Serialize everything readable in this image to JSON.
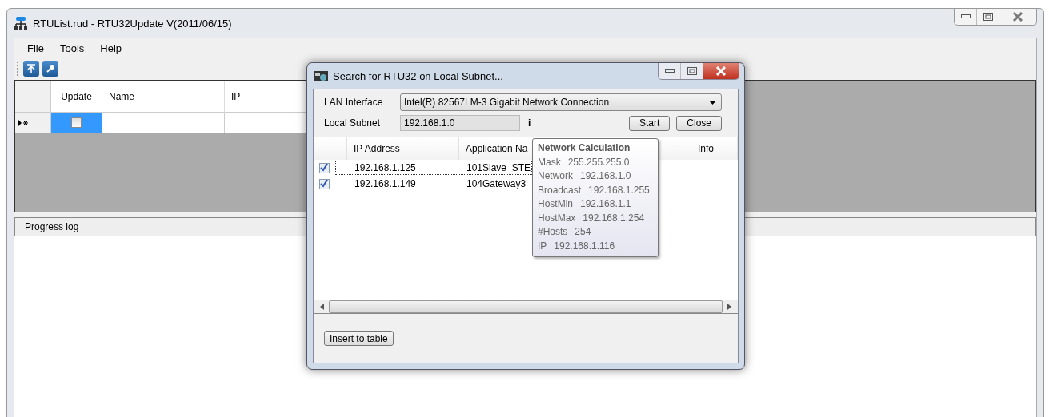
{
  "window": {
    "title": "RTUList.rud - RTU32Update V(2011/06/15)"
  },
  "menu": [
    "File",
    "Tools",
    "Help"
  ],
  "grid": {
    "columns": [
      "Update",
      "Name",
      "IP"
    ],
    "new_row": {
      "update_checked": false,
      "selected": true
    }
  },
  "progress_log": {
    "title": "Progress log"
  },
  "dialog": {
    "title": "Search for RTU32 on Local Subnet...",
    "lan_interface": {
      "label": "LAN Interface",
      "value": "Intel(R) 82567LM-3 Gigabit Network Connection"
    },
    "local_subnet": {
      "label": "Local Subnet",
      "value": "192.168.1.0"
    },
    "info_marker": "i",
    "buttons": [
      "Start",
      "Close"
    ],
    "columns": [
      "IP Address",
      "Application Na",
      "Info"
    ],
    "rows": [
      {
        "checked": true,
        "ip": "192.168.1.125",
        "application": "101Slave_STE",
        "focused": true
      },
      {
        "checked": true,
        "ip": "192.168.1.149",
        "application": "104Gateway3",
        "focused": false
      }
    ],
    "insert_button": "Insert to table",
    "tooltip": {
      "title": "Network Calculation",
      "lines": [
        {
          "label": "Mask",
          "value": "255.255.255.0"
        },
        {
          "label": "Network",
          "value": "192.168.1.0"
        },
        {
          "label": "Broadcast",
          "value": "192.168.1.255"
        },
        {
          "label": "HostMin",
          "value": "192.168.1.1"
        },
        {
          "label": "HostMax",
          "value": "192.168.1.254"
        },
        {
          "label": "#Hosts",
          "value": "254"
        },
        {
          "label": "IP",
          "value": "192.168.1.116"
        }
      ]
    }
  }
}
